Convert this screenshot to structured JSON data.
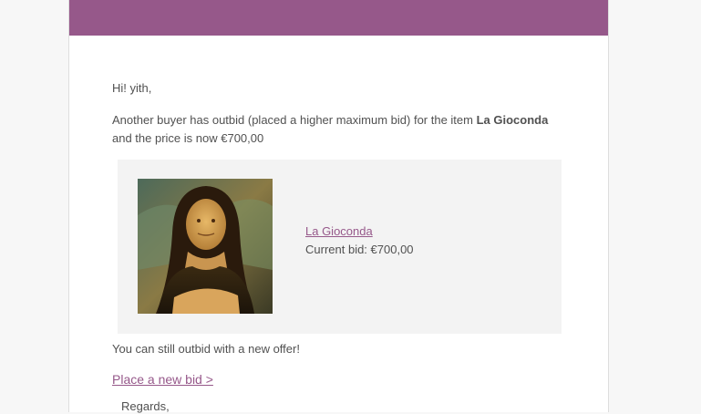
{
  "colors": {
    "brand": "#96588a",
    "text": "#515151",
    "box_background": "#f3f3f3"
  },
  "email": {
    "greeting": "Hi! yith,",
    "notice_prefix": "Another buyer has outbid (placed a higher maximum bid) for the item ",
    "notice_item": "La Gioconda",
    "notice_suffix": " and the price is now €700,00",
    "item": {
      "image_icon": "mona-lisa-painting",
      "name": "La Gioconda",
      "current_bid": "Current bid: €700,00"
    },
    "outbid_text": "You can still outbid with a new offer!",
    "bid_link": "Place a new bid >",
    "regards": "Regards,"
  }
}
